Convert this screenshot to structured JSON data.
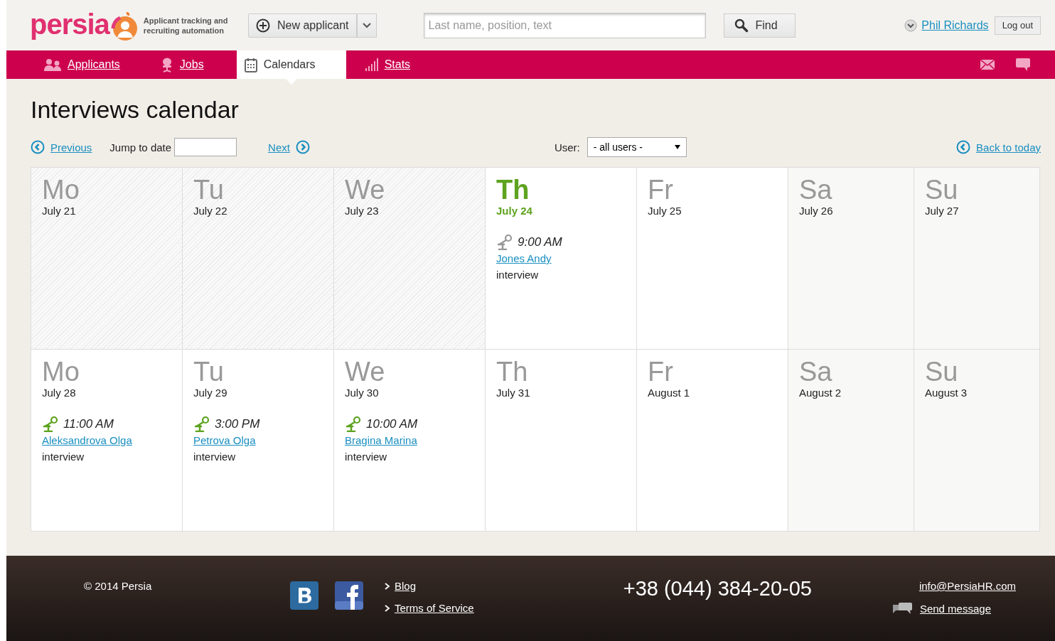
{
  "header": {
    "logo": "persia",
    "tagline": "Applicant tracking and recruiting automation",
    "new_button": "New applicant",
    "search": {
      "placeholder": "Last name, position, text"
    },
    "find_button": "Find",
    "user": "Phil Richards",
    "logout": "Log out"
  },
  "nav": [
    {
      "label": "Applicants",
      "selected": false
    },
    {
      "label": "Jobs",
      "selected": false
    },
    {
      "label": "Calendars",
      "selected": true
    },
    {
      "label": "Stats",
      "selected": false
    }
  ],
  "page_title": "Interviews calendar",
  "toolbar": {
    "previous": "Previous",
    "jump_label": "Jump to date",
    "next": "Next",
    "user_label": "User:",
    "user_select": "- all users -",
    "back_today": "Back to today"
  },
  "weeks": [
    [
      {
        "weekday": "Mo",
        "date": "July 21",
        "kind": "past"
      },
      {
        "weekday": "Tu",
        "date": "July 22",
        "kind": "past"
      },
      {
        "weekday": "We",
        "date": "July 23",
        "kind": "past"
      },
      {
        "weekday": "Th",
        "date": "July 24",
        "kind": "today",
        "events": [
          {
            "time": "9:00 AM",
            "name": "Jones Andy",
            "type": "interview",
            "done": true
          }
        ]
      },
      {
        "weekday": "Fr",
        "date": "July 25",
        "kind": "weekday"
      },
      {
        "weekday": "Sa",
        "date": "July 26",
        "kind": "weekend"
      },
      {
        "weekday": "Su",
        "date": "July 27",
        "kind": "weekend"
      }
    ],
    [
      {
        "weekday": "Mo",
        "date": "July 28",
        "kind": "weekday",
        "events": [
          {
            "time": "11:00 AM",
            "name": "Aleksandrova Olga",
            "type": "interview",
            "done": false
          }
        ]
      },
      {
        "weekday": "Tu",
        "date": "July 29",
        "kind": "weekday",
        "events": [
          {
            "time": "3:00 PM",
            "name": "Petrova Olga",
            "type": "interview",
            "done": false
          }
        ]
      },
      {
        "weekday": "We",
        "date": "July 30",
        "kind": "weekday",
        "events": [
          {
            "time": "10:00 AM",
            "name": "Bragina Marina",
            "type": "interview",
            "done": false
          }
        ]
      },
      {
        "weekday": "Th",
        "date": "July 31",
        "kind": "weekday"
      },
      {
        "weekday": "Fr",
        "date": "August 1",
        "kind": "weekday"
      },
      {
        "weekday": "Sa",
        "date": "August 2",
        "kind": "weekend"
      },
      {
        "weekday": "Su",
        "date": "August 3",
        "kind": "weekend"
      }
    ]
  ],
  "footer": {
    "copyright": "© 2014 Persia",
    "links": [
      "Blog",
      "Terms of Service"
    ],
    "phone": "+38 (044) 384-20-05",
    "email": "info@PersiaHR.com",
    "send_message": "Send message"
  }
}
